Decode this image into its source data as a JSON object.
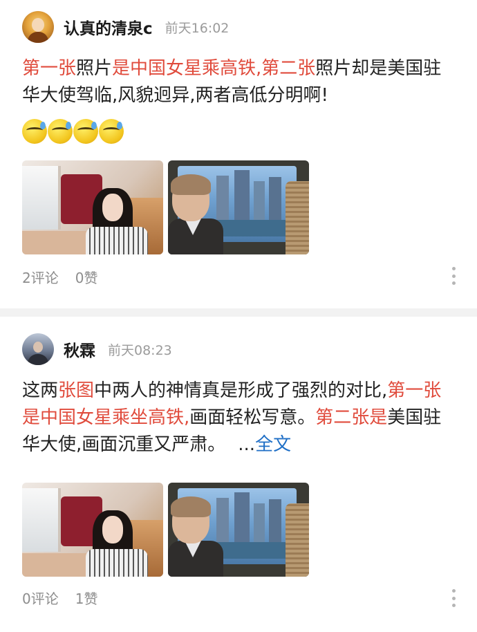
{
  "posts": [
    {
      "username": "认真的清泉c",
      "time": "前天16:02",
      "content": [
        {
          "text": "第一张",
          "style": "red"
        },
        {
          "text": "照片",
          "style": "normal"
        },
        {
          "text": "是中国女星乘高铁,第二张",
          "style": "red"
        },
        {
          "text": "照片却是美国驻华大使驾临,风貌迥异,两者高低分明啊!",
          "style": "normal"
        }
      ],
      "emoji_count": 4,
      "emoji_icon": "sweat-smile-emoji-icon",
      "photos": [
        "actress-on-train-photo",
        "ambassador-on-train-photo"
      ],
      "comments": "2评论",
      "likes": "0赞"
    },
    {
      "username": "秋霖",
      "time": "前天08:23",
      "content": [
        {
          "text": "这两",
          "style": "normal"
        },
        {
          "text": "张图",
          "style": "red"
        },
        {
          "text": "中两人的神情真是形成了强烈的对比,",
          "style": "normal"
        },
        {
          "text": "第一张是中国女星乘坐高铁,",
          "style": "red"
        },
        {
          "text": "画面轻松写意。",
          "style": "normal"
        },
        {
          "text": "第二张是",
          "style": "red"
        },
        {
          "text": "美国驻华大使,画面沉重又严肃。",
          "style": "normal"
        }
      ],
      "ellipsis": "...",
      "more_label": "全文",
      "photos": [
        "actress-on-train-photo",
        "ambassador-on-train-photo"
      ],
      "comments": "0评论",
      "likes": "1赞"
    }
  ],
  "colors": {
    "highlight": "#e04b3c",
    "link": "#1f6fc6",
    "muted": "#9b9b9b"
  }
}
